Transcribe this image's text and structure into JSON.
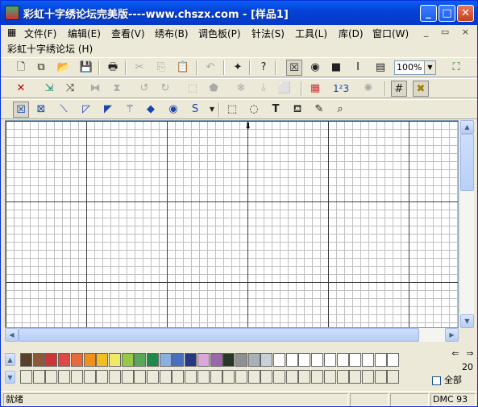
{
  "window": {
    "title": "彩虹十字绣论坛完美版----www.chszx.com - [样品1]",
    "child_title": "彩虹十字绣论坛 (H)"
  },
  "menu": [
    "文件(F)",
    "编辑(E)",
    "查看(V)",
    "绣布(B)",
    "调色板(P)",
    "针法(S)",
    "工具(L)",
    "库(D)",
    "窗口(W)"
  ],
  "mdi_controls": "_ ▭ ×",
  "toolbar": {
    "zoom": "100%"
  },
  "palette": {
    "count": "20",
    "all_label": "全部",
    "colors": [
      "#5a4028",
      "#8a5a3a",
      "#c83838",
      "#e04848",
      "#e86a3a",
      "#f09020",
      "#f0c020",
      "#f0e868",
      "#98c848",
      "#58a858",
      "#208848",
      "#8ab0e0",
      "#4870c0",
      "#283880",
      "#d8a8d8",
      "#9868a8",
      "#283828",
      "#909090",
      "#a8b0b8",
      "#c8d0d8",
      "#ffffff",
      "#ffffff",
      "#ffffff",
      "#ffffff",
      "#ffffff",
      "#ffffff",
      "#ffffff",
      "#ffffff",
      "#ffffff",
      "#ffffff"
    ]
  },
  "status": {
    "text": "就绪",
    "dmc": "DMC  93"
  }
}
